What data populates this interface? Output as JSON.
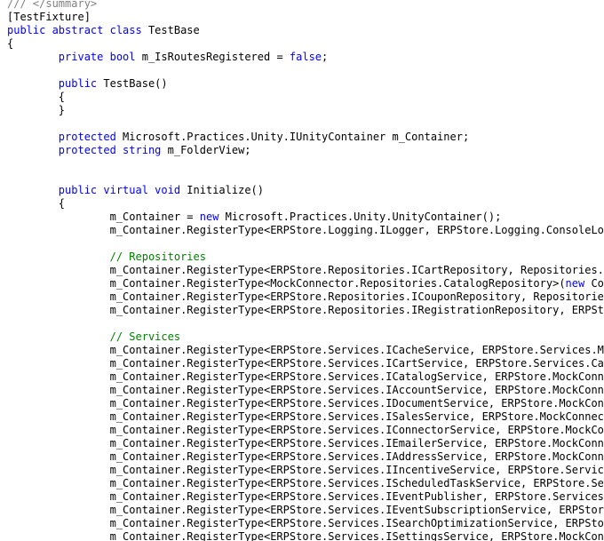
{
  "colors": {
    "keyword": "#0000ff",
    "comment": "#008000",
    "doc_comment": "#808080",
    "text": "#000000",
    "background": "#ffffff"
  },
  "lines": [
    [
      {
        "t": "/// </summary>",
        "c": "g"
      }
    ],
    [
      {
        "t": "[TestFixture]",
        "c": "t"
      }
    ],
    [
      {
        "t": "public abstract class",
        "c": "k"
      },
      {
        "t": " TestBase",
        "c": "t"
      }
    ],
    [
      {
        "t": "{",
        "c": "t"
      }
    ],
    [
      {
        "t": "        ",
        "c": "t"
      },
      {
        "t": "private bool",
        "c": "k"
      },
      {
        "t": " m_IsRoutesRegistered = ",
        "c": "t"
      },
      {
        "t": "false",
        "c": "k"
      },
      {
        "t": ";",
        "c": "t"
      }
    ],
    [],
    [
      {
        "t": "        ",
        "c": "t"
      },
      {
        "t": "public",
        "c": "k"
      },
      {
        "t": " TestBase()",
        "c": "t"
      }
    ],
    [
      {
        "t": "        {",
        "c": "t"
      }
    ],
    [
      {
        "t": "        }",
        "c": "t"
      }
    ],
    [],
    [
      {
        "t": "        ",
        "c": "t"
      },
      {
        "t": "protected",
        "c": "k"
      },
      {
        "t": " Microsoft.Practices.Unity.IUnityContainer m_Container;",
        "c": "t"
      }
    ],
    [
      {
        "t": "        ",
        "c": "t"
      },
      {
        "t": "protected string",
        "c": "k"
      },
      {
        "t": " m_FolderView;",
        "c": "t"
      }
    ],
    [],
    [],
    [
      {
        "t": "        ",
        "c": "t"
      },
      {
        "t": "public virtual void",
        "c": "k"
      },
      {
        "t": " Initialize()",
        "c": "t"
      }
    ],
    [
      {
        "t": "        {",
        "c": "t"
      }
    ],
    [
      {
        "t": "                m_Container = ",
        "c": "t"
      },
      {
        "t": "new",
        "c": "k"
      },
      {
        "t": " Microsoft.Practices.Unity.UnityContainer();",
        "c": "t"
      }
    ],
    [
      {
        "t": "                m_Container.RegisterType<ERPStore.Logging.ILogger, ERPStore.Logging.ConsoleLogger>",
        "c": "t"
      }
    ],
    [],
    [
      {
        "t": "                ",
        "c": "t"
      },
      {
        "t": "// Repositories",
        "c": "c"
      }
    ],
    [
      {
        "t": "                m_Container.RegisterType<ERPStore.Repositories.ICartRepository, Repositories.MockCartRepository>",
        "c": "t"
      }
    ],
    [
      {
        "t": "                m_Container.RegisterType<MockConnector.Repositories.CatalogRepository>(",
        "c": "t"
      },
      {
        "t": "new",
        "c": "k"
      },
      {
        "t": " ContainerControlledLifetimeManager",
        "c": "t"
      }
    ],
    [
      {
        "t": "                m_Container.RegisterType<ERPStore.Repositories.ICouponRepository, Repositories.MockCouponRepository>",
        "c": "t"
      }
    ],
    [
      {
        "t": "                m_Container.RegisterType<ERPStore.Repositories.IRegistrationRepository, ERPStore.Repositories",
        "c": "t"
      }
    ],
    [],
    [
      {
        "t": "                ",
        "c": "t"
      },
      {
        "t": "// Services",
        "c": "c"
      }
    ],
    [
      {
        "t": "                m_Container.RegisterType<ERPStore.Services.ICacheService, ERPStore.Services.MixedCacheService>",
        "c": "t"
      }
    ],
    [
      {
        "t": "                m_Container.RegisterType<ERPStore.Services.ICartService, ERPStore.Services.CartService>",
        "c": "t"
      }
    ],
    [
      {
        "t": "                m_Container.RegisterType<ERPStore.Services.ICatalogService, ERPStore.MockConnector.Services",
        "c": "t"
      }
    ],
    [
      {
        "t": "                m_Container.RegisterType<ERPStore.Services.IAccountService, ERPStore.MockConnector.Services",
        "c": "t"
      }
    ],
    [
      {
        "t": "                m_Container.RegisterType<ERPStore.Services.IDocumentService, ERPStore.MockConnector.Services",
        "c": "t"
      }
    ],
    [
      {
        "t": "                m_Container.RegisterType<ERPStore.Services.ISalesService, ERPStore.MockConnector.Services",
        "c": "t"
      }
    ],
    [
      {
        "t": "                m_Container.RegisterType<ERPStore.Services.IConnectorService, ERPStore.MockConnector.Services",
        "c": "t"
      }
    ],
    [
      {
        "t": "                m_Container.RegisterType<ERPStore.Services.IEmailerService, ERPStore.MockConnector.Services",
        "c": "t"
      }
    ],
    [
      {
        "t": "                m_Container.RegisterType<ERPStore.Services.IAddressService, ERPStore.MockConnector.Services",
        "c": "t"
      }
    ],
    [
      {
        "t": "                m_Container.RegisterType<ERPStore.Services.IIncentiveService, ERPStore.Services.IncentiveService>",
        "c": "t"
      }
    ],
    [
      {
        "t": "                m_Container.RegisterType<ERPStore.Services.IScheduledTaskService, ERPStore.Services.ScheduledTaskService>",
        "c": "t"
      }
    ],
    [
      {
        "t": "                m_Container.RegisterType<ERPStore.Services.IEventPublisher, ERPStore.Services.EventPublisher>",
        "c": "t"
      }
    ],
    [
      {
        "t": "                m_Container.RegisterType<ERPStore.Services.IEventSubscriptionService, ERPStore.Services",
        "c": "t"
      }
    ],
    [
      {
        "t": "                m_Container.RegisterType<ERPStore.Services.ISearchOptimizationService, ERPStore.Services",
        "c": "t"
      }
    ],
    [
      {
        "t": "                m_Container.RegisterType<ERPStore.Services.ISettingsService, ERPStore.MockConnector",
        "c": "t"
      }
    ]
  ]
}
